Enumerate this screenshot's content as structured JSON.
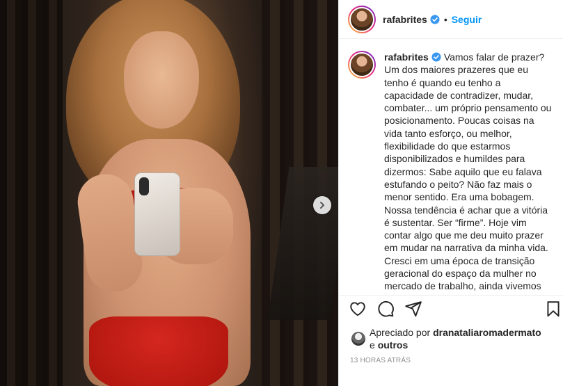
{
  "post": {
    "username": "rafabrites",
    "follow_label": "Seguir",
    "dot": "•"
  },
  "caption": {
    "username": "rafabrites",
    "text": "Vamos falar de prazer? Um dos maiores prazeres que eu tenho é quando eu tenho a capacidade de contradizer, mudar, combater... um próprio pensamento ou posicionamento. Poucas coisas na vida tanto esforço, ou melhor, flexibilidade do que estarmos disponibilizados e humildes para dizermos: Sabe aquilo que eu falava estufando o peito? Não faz mais o menor sentido. Era uma bobagem. Nossa tendência é achar que a vitória é sustentar. Ser “firme”. Hoje vim contar algo que me deu muito prazer em mudar na narrativa da minha vida. Cresci em uma época de transição geracional do espaço da mulher no mercado de trabalho, ainda vivemos essa época e felizmente com a oportunidade. O fato é"
  },
  "likes": {
    "prefix": "Apreciado por",
    "user": "dranataliaromadermato",
    "and": "e",
    "others": "outros"
  },
  "timestamp": "13 HORAS ATRÁS",
  "icons": {
    "verified": "verified-badge-icon",
    "like": "heart-icon",
    "comment": "comment-icon",
    "share": "share-icon",
    "save": "bookmark-icon",
    "next": "chevron-right-icon"
  },
  "colors": {
    "link": "#0095f6",
    "verified": "#3897f0",
    "muted": "#8e8e8e"
  }
}
